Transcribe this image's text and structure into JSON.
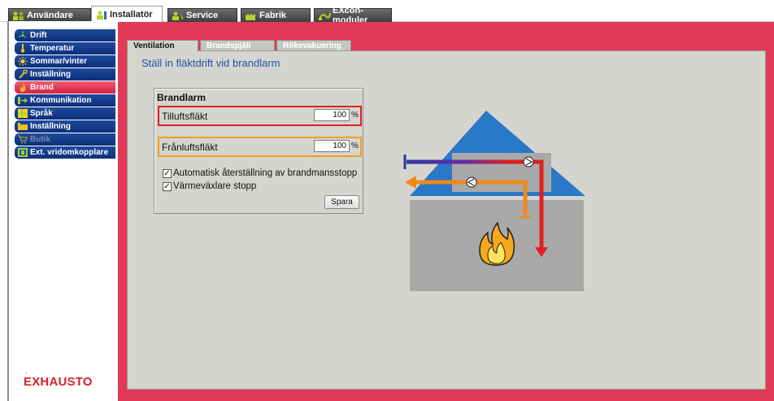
{
  "top_tabs": [
    {
      "label": "Användare",
      "icon": "users-icon"
    },
    {
      "label": "Installatör",
      "icon": "installer-icon",
      "active": true
    },
    {
      "label": "Service",
      "icon": "service-icon"
    },
    {
      "label": "Fabrik",
      "icon": "factory-icon"
    },
    {
      "label": "EXcon-moduler",
      "icon": "module-icon"
    }
  ],
  "sidebar": {
    "items": [
      {
        "label": "Drift",
        "icon": "fan-icon"
      },
      {
        "label": "Temperatur",
        "icon": "thermometer-icon"
      },
      {
        "label": "Sommar/vinter",
        "icon": "sun-icon"
      },
      {
        "label": "Inställning",
        "icon": "wrench-icon"
      },
      {
        "label": "Brand",
        "icon": "fire-icon",
        "active": true
      },
      {
        "label": "Kommunikation",
        "icon": "communication-icon"
      },
      {
        "label": "Språk",
        "icon": "language-flag-icon"
      },
      {
        "label": "Inställning",
        "icon": "display-icon"
      },
      {
        "label": "Butik",
        "icon": "cart-icon",
        "disabled": true
      },
      {
        "label": "Ext. vridomkopplare",
        "icon": "switch-icon"
      }
    ]
  },
  "brand": {
    "logo_text": "EXHAUSTO",
    "dot": "-"
  },
  "content_tabs": [
    {
      "label": "Ventilation",
      "active": true
    },
    {
      "label": "Brandspjäll"
    },
    {
      "label": "Rökevakuering"
    }
  ],
  "heading": "Ställ in fläktdrift vid brandlarm",
  "panel": {
    "title": "Brandlarm",
    "supply_fan": {
      "label": "Tilluftsfläkt",
      "value": "100",
      "unit": "%"
    },
    "exhaust_fan": {
      "label": "Frånluftsfläkt",
      "value": "100",
      "unit": "%"
    },
    "auto_reset": {
      "label": "Automatisk återställning av brandmansstopp",
      "checked": true,
      "mark": "✓"
    },
    "hx_stop": {
      "label": "Värmeväxlare stopp",
      "checked": true,
      "mark": "✓"
    },
    "save_label": "Spara"
  },
  "colors": {
    "frame_pink": "#e23a56",
    "menu_blue": "#1d4a9e",
    "content_bg": "#d5d5d0",
    "heading_blue": "#2352a8",
    "supply_red": "#e02020",
    "exhaust_orange": "#f0a020"
  }
}
